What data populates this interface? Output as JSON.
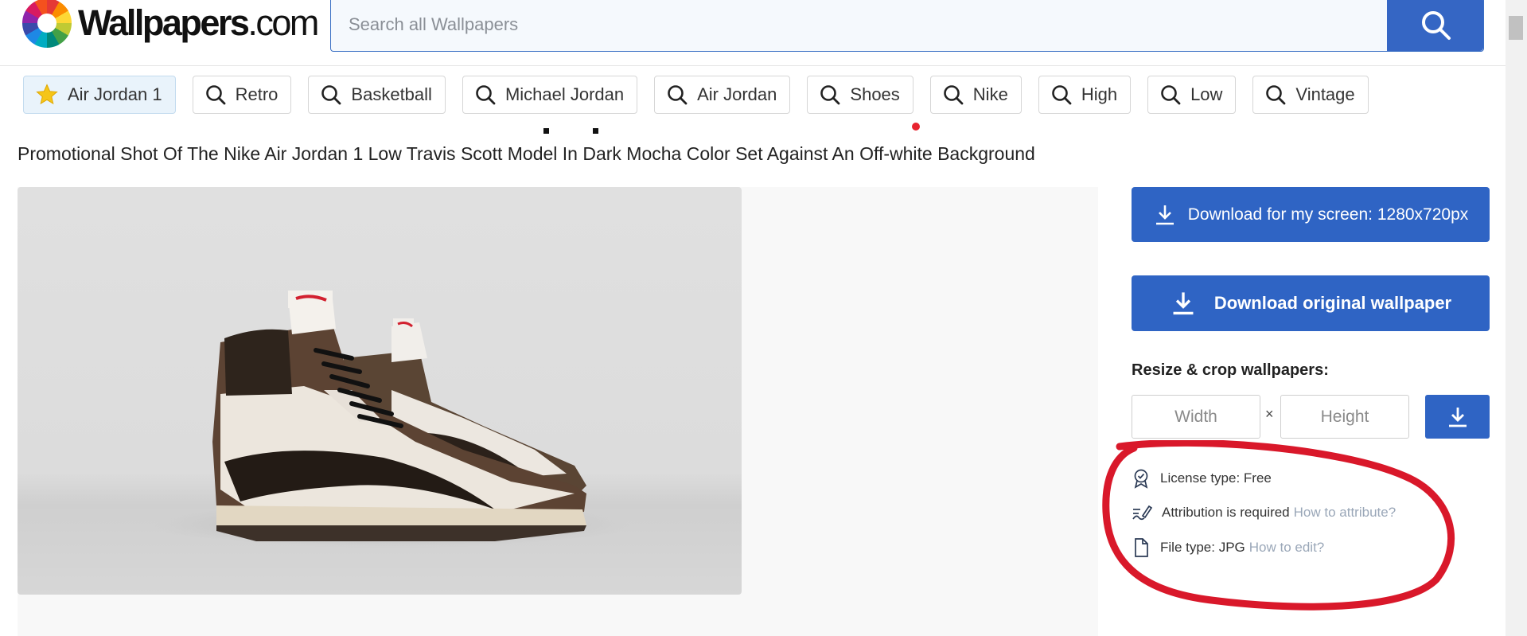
{
  "brand": {
    "name": "Wallpapers",
    "tld": ".com"
  },
  "search": {
    "placeholder": "Search all Wallpapers"
  },
  "tags": [
    {
      "label": "Air Jordan 1",
      "icon": "star-icon",
      "active": true
    },
    {
      "label": "Retro",
      "icon": "search-icon"
    },
    {
      "label": "Basketball",
      "icon": "search-icon"
    },
    {
      "label": "Michael Jordan",
      "icon": "search-icon"
    },
    {
      "label": "Air Jordan",
      "icon": "search-icon"
    },
    {
      "label": "Shoes",
      "icon": "search-icon"
    },
    {
      "label": "Nike",
      "icon": "search-icon"
    },
    {
      "label": "High",
      "icon": "search-icon"
    },
    {
      "label": "Low",
      "icon": "search-icon"
    },
    {
      "label": "Vintage",
      "icon": "search-icon"
    }
  ],
  "page_title": "Promotional Shot Of The Nike Air Jordan 1 Low Travis Scott Model In Dark Mocha Color Set Against An Off-white Background",
  "image": {
    "alt": "Nike Air Jordan 1 Travis Scott dark mocha sneakers"
  },
  "download": {
    "screen_label": "Download for my screen: 1280x720px",
    "original_label": "Download original wallpaper"
  },
  "resize": {
    "label": "Resize & crop wallpapers:",
    "width_placeholder": "Width",
    "height_placeholder": "Height",
    "times": "×"
  },
  "info": {
    "license": "License type: Free",
    "attribution": "Attribution is required",
    "attribution_link": "How to attribute?",
    "file_type": "File type: JPG",
    "edit_link": "How to edit?"
  },
  "colors": {
    "primary": "#2f64c4",
    "link_muted": "#9aa7b8",
    "annotation": "#d9182a",
    "active_tag_bg": "#e9f3fb"
  }
}
